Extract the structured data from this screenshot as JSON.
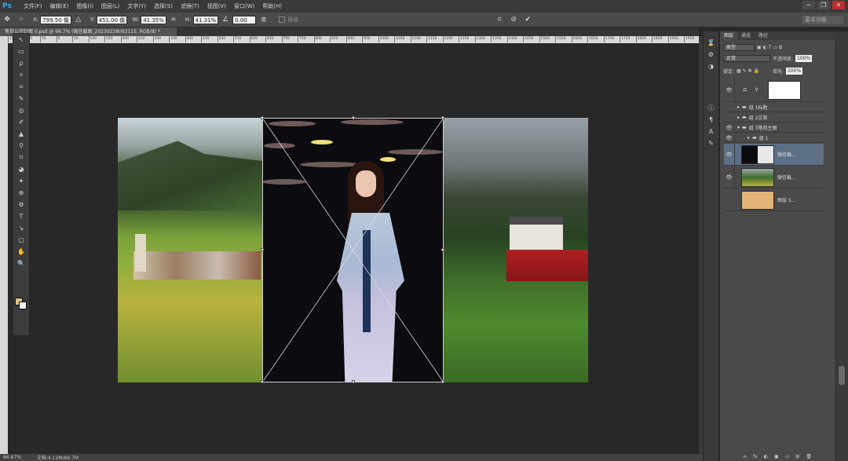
{
  "app": {
    "logo": "Ps"
  },
  "menu": [
    "文件(F)",
    "编辑(E)",
    "图像(I)",
    "图层(L)",
    "文字(Y)",
    "选择(S)",
    "滤镜(T)",
    "视图(V)",
    "窗口(W)",
    "帮助(H)"
  ],
  "window_controls": [
    "−",
    "❐",
    "✕"
  ],
  "options": {
    "x_label": "X:",
    "x_value": "799.50 像",
    "y_label": "Y:",
    "y_value": "451.00 像",
    "w_label": "W:",
    "w_value": "41.35%",
    "h_label": "H:",
    "h_value": "41.31%",
    "angle_value": "0.00",
    "angle_unit": "度",
    "interp_label": "插值",
    "right_dropdown": "基本功能"
  },
  "document": {
    "tab": "笔荷公司封面 0.psd @ 66.7% (微信截图_20230228093115, RGB/8) *"
  },
  "ruler_ticks": [
    "150",
    "100",
    "50",
    "0",
    "50",
    "100",
    "150",
    "200",
    "250",
    "300",
    "350",
    "400",
    "450",
    "500",
    "550",
    "600",
    "650",
    "700",
    "750",
    "800",
    "850",
    "900",
    "950",
    "1000",
    "1050",
    "1100",
    "1150",
    "1200",
    "1250",
    "1300",
    "1350",
    "1400",
    "1450",
    "1500",
    "1550",
    "1600",
    "1650",
    "1700",
    "1750",
    "1800",
    "1850",
    "1900",
    "1950"
  ],
  "status": {
    "zoom": "66.67%",
    "doc": "文档:4.12M/69.7M"
  },
  "tools": [
    "↖",
    "▭",
    "ρ",
    "✧",
    "⌗",
    "✎",
    "◎",
    "✐",
    "▲",
    "⚲",
    "⌑",
    "◕",
    "✦",
    "⊕",
    "⚙",
    "T",
    "↘",
    "▢",
    "✋",
    "🔍"
  ],
  "panel": {
    "tabs": [
      "图层",
      "通道",
      "路径"
    ],
    "filter_label": "类型",
    "blend_mode": "正常",
    "opacity_label": "不透明度:",
    "opacity_value": "100%",
    "lock_label": "锁定:",
    "fill_label": "填充:",
    "fill_value": "100%",
    "layers": [
      {
        "name": "",
        "type": "adjustment"
      },
      {
        "name": "组 1标题",
        "type": "group"
      },
      {
        "name": "组 2文案",
        "type": "group"
      },
      {
        "name": "组 3笔荷主图",
        "type": "group-open"
      },
      {
        "name": "组 1",
        "type": "group-sub"
      },
      {
        "name": "微信截...",
        "type": "layer-selected"
      },
      {
        "name": "微信截...",
        "type": "layer"
      },
      {
        "name": "图层 5...",
        "type": "layer"
      }
    ],
    "bottom_icons": [
      "∞",
      "fx",
      "◐",
      "▣",
      "▭",
      "⊞",
      "🗑"
    ]
  },
  "colors": {
    "accent": "#31a8ff",
    "selected_layer": "#5d6f87",
    "foreground": "#d8c58a"
  }
}
